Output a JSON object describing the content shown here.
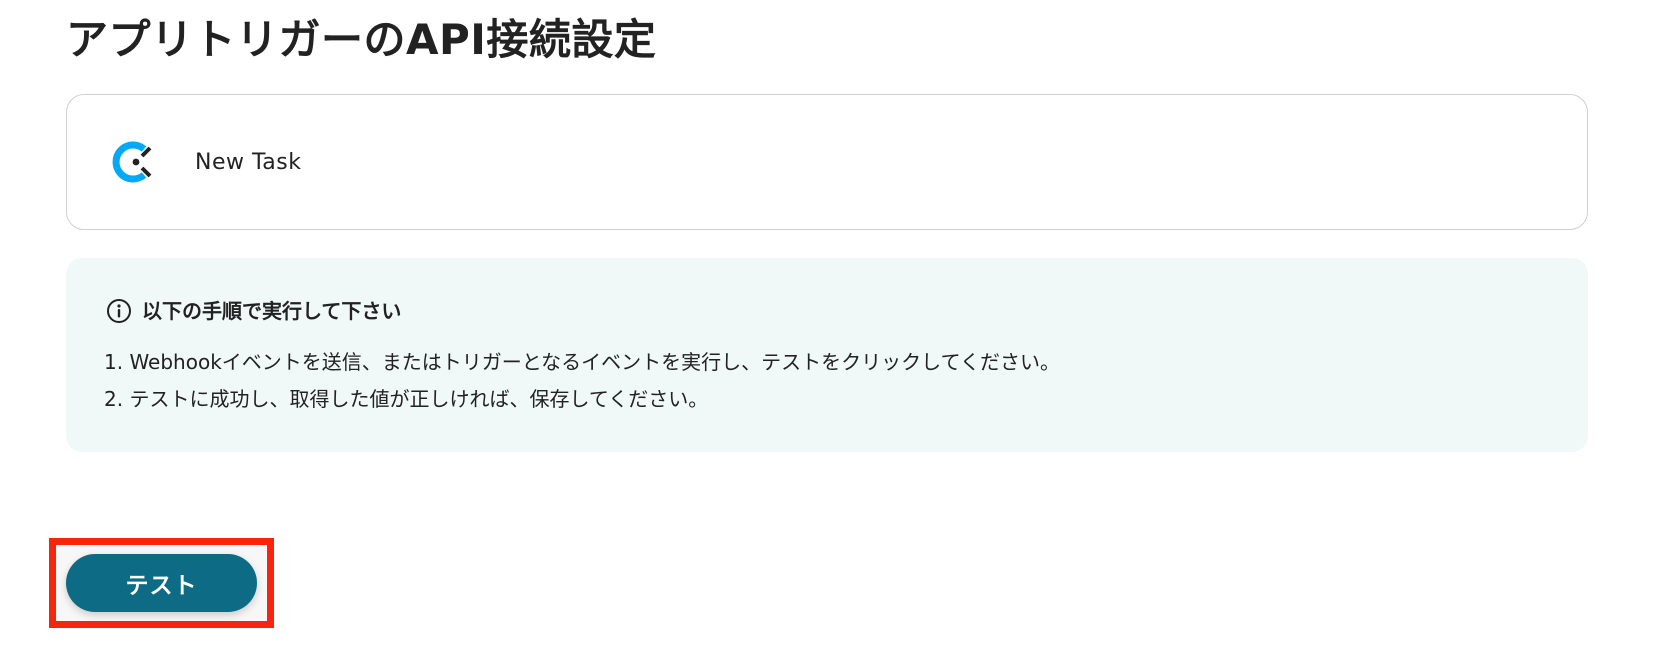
{
  "page": {
    "title": "アプリトリガーのAPI接続設定"
  },
  "app_card": {
    "icon": "clockify-logo-icon",
    "label": "New Task"
  },
  "info": {
    "icon": "info-circle-icon",
    "heading": "以下の手順で実行して下さい",
    "steps": [
      "1. Webhookイベントを送信、またはトリガーとなるイベントを実行し、テストをクリックしてください。",
      "2. テストに成功し、取得した値が正しければ、保存してください。"
    ]
  },
  "actions": {
    "test_label": "テスト"
  },
  "colors": {
    "button_bg": "#0d6b85",
    "info_bg": "#f1f8f8",
    "highlight_border": "#f5260d",
    "logo_blue": "#03a9f4",
    "logo_dark": "#222222"
  }
}
